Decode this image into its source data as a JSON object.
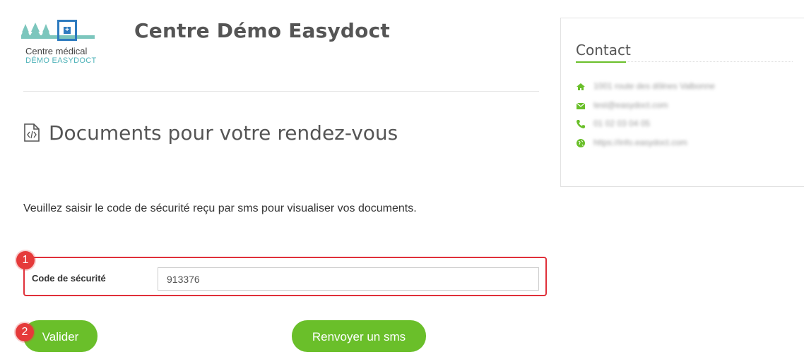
{
  "header": {
    "logo_line1": "Centre médical",
    "logo_line2": "DÉMO EASYDOCT",
    "site_title": "Centre Démo Easydoct"
  },
  "main": {
    "page_title": "Documents pour votre rendez-vous",
    "instruction": "Veuillez saisir le code de sécurité reçu par sms pour visualiser vos documents.",
    "security_code": {
      "label": "Code de sécurité",
      "value": "913376"
    },
    "buttons": {
      "validate": "Valider",
      "resend": "Renvoyer un sms"
    }
  },
  "annotations": {
    "badge1": "1",
    "badge2": "2"
  },
  "contact": {
    "title": "Contact",
    "address": "1001 route des dôlnes Valbonne",
    "email": "test@easydoct.com",
    "phone": "01 02 03 04 05",
    "website": "https://info.easydoct.com"
  },
  "colors": {
    "accent_green": "#6abf2a",
    "annotation_red": "#e0303a",
    "logo_blue": "#2e7bbf",
    "logo_teal": "#7cc6bd"
  },
  "icons": {
    "address": "home-icon",
    "email": "envelope-icon",
    "phone": "phone-icon",
    "website": "globe-icon",
    "title": "document-code-icon"
  }
}
